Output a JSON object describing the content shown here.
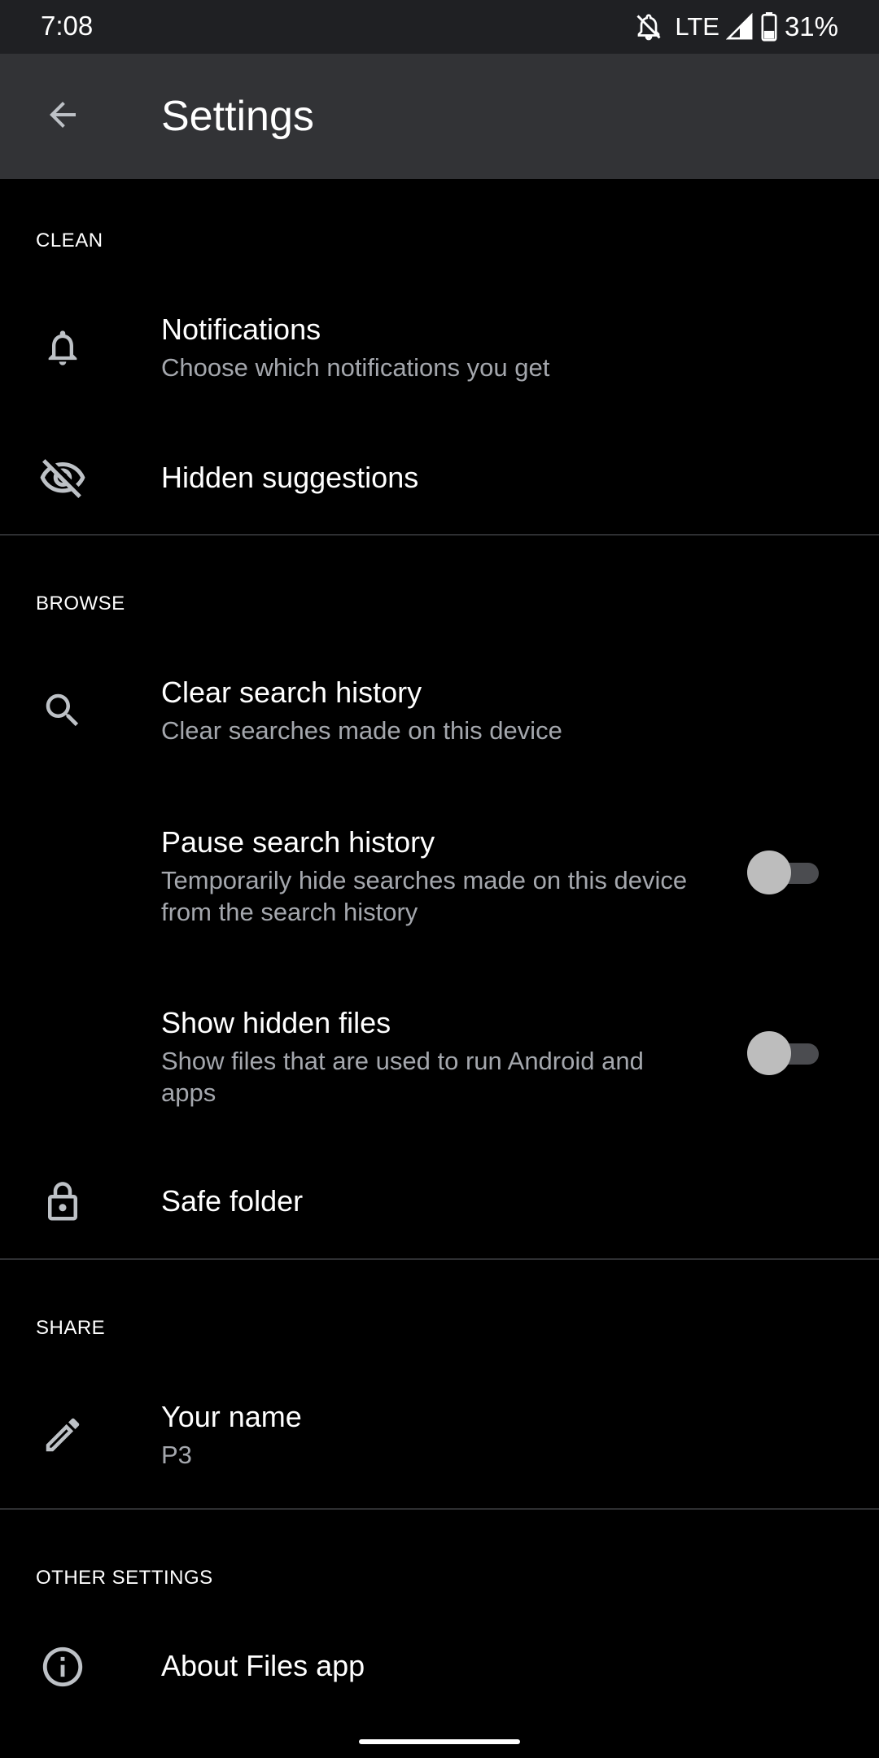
{
  "status_bar": {
    "time": "7:08",
    "network": "LTE",
    "battery": "31%",
    "icons": [
      "notifications-off-icon",
      "signal-icon",
      "battery-icon"
    ]
  },
  "app_bar": {
    "title": "Settings",
    "back_icon": "arrow-back-icon"
  },
  "sections": {
    "clean": {
      "header": "CLEAN",
      "items": [
        {
          "title": "Notifications",
          "subtitle": "Choose which notifications you get",
          "icon": "bell-icon"
        },
        {
          "title": "Hidden suggestions",
          "icon": "eye-off-icon"
        }
      ]
    },
    "browse": {
      "header": "BROWSE",
      "items": [
        {
          "title": "Clear search history",
          "subtitle": "Clear searches made on this device",
          "icon": "search-icon"
        },
        {
          "title": "Pause search history",
          "subtitle": "Temporarily hide searches made on this device from the search history",
          "toggle": false
        },
        {
          "title": "Show hidden files",
          "subtitle": "Show files that are used to run Android and apps",
          "toggle": false
        },
        {
          "title": "Safe folder",
          "icon": "lock-icon"
        }
      ]
    },
    "share": {
      "header": "SHARE",
      "items": [
        {
          "title": "Your name",
          "subtitle": "P3",
          "icon": "pencil-icon"
        }
      ]
    },
    "other": {
      "header": "OTHER SETTINGS",
      "items": [
        {
          "title": "About Files app",
          "icon": "info-icon"
        }
      ]
    }
  },
  "colors": {
    "background": "#000000",
    "status_bar": "#1f2023",
    "app_bar": "#323336",
    "subtitle_text": "#a4a7ad",
    "icon": "#bdc1c6",
    "divider": "#2e2f32",
    "toggle_thumb": "#bdbdbd",
    "toggle_track": "#4b4c50"
  }
}
